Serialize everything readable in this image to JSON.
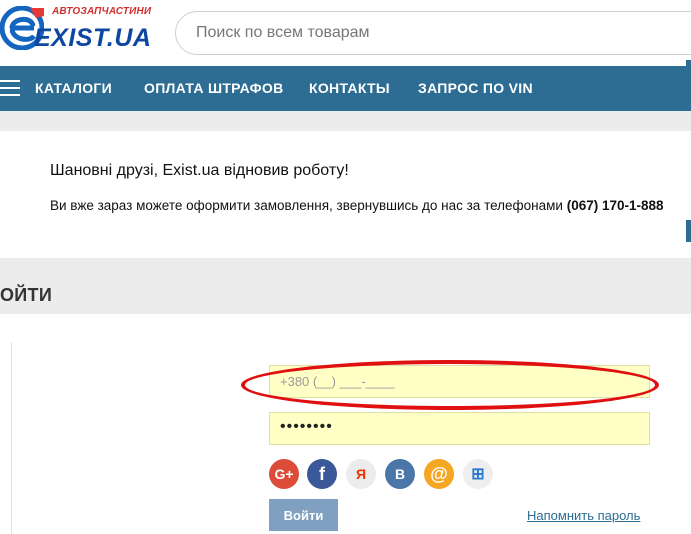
{
  "header": {
    "logo_tagline": "АВТОЗАПЧАСТИНИ",
    "logo_name": "EXIST.UA",
    "search_placeholder": "Поиск по всем товарам"
  },
  "nav": {
    "items": [
      "КАТАЛОГИ",
      "ОПЛАТА ШТРАФОВ",
      "КОНТАКТЫ",
      "ЗАПРОС ПО VIN"
    ]
  },
  "notice": {
    "title": "Шановні друзі, Exist.ua відновив роботу!",
    "body": "Ви вже зараз можете оформити замовлення, звернувшись до нас за телефонами",
    "phone": "(067) 170-1-888"
  },
  "login": {
    "title": "ОЙТИ",
    "phone_placeholder": "+380 (__) ___-____",
    "password_value": "••••••••",
    "submit_label": "Войти",
    "remind_label": "Напомнить пароль"
  },
  "socials": [
    {
      "name": "google-plus",
      "glyph": "G+",
      "color": "#dd4b39"
    },
    {
      "name": "facebook",
      "glyph": "f",
      "color": "#3b5998"
    },
    {
      "name": "yandex",
      "glyph": "Я",
      "color": "#e5e5e5"
    },
    {
      "name": "vkontakte",
      "glyph": "B",
      "color": "#4a76a8"
    },
    {
      "name": "mail",
      "glyph": "@",
      "color": "#f5a623"
    },
    {
      "name": "windows-live",
      "glyph": "⊞",
      "color": "#eeeeee"
    }
  ],
  "colors": {
    "nav_bg": "#2d6d93",
    "input_bg": "#ffffc6",
    "highlight": "#e01010"
  }
}
